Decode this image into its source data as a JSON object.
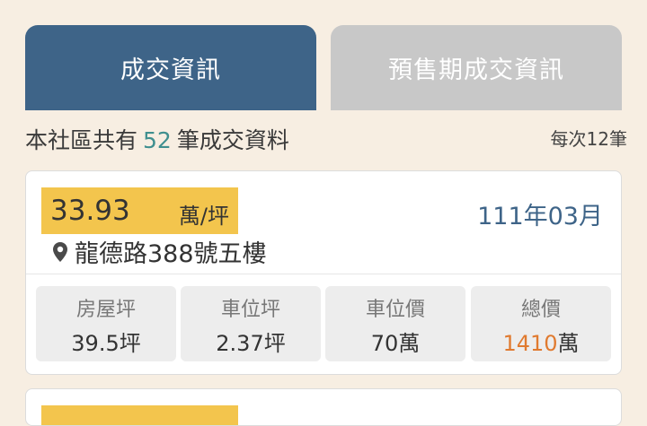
{
  "tabs": [
    {
      "label": "成交資訊",
      "active": true
    },
    {
      "label": "預售期成交資訊",
      "active": false
    }
  ],
  "summary": {
    "prefix": "本社區共有",
    "count": "52",
    "suffix": "筆成交資料",
    "per_page": "每次12筆"
  },
  "record": {
    "price_value": "33.93",
    "price_unit": "萬/坪",
    "date": "111年03月",
    "address": "龍德路388號五樓",
    "stats": [
      {
        "label": "房屋坪",
        "value": "39.5坪"
      },
      {
        "label": "車位坪",
        "value": "2.37坪"
      },
      {
        "label": "車位價",
        "value": "70萬"
      },
      {
        "label": "總價",
        "number": "1410",
        "unit": "萬"
      }
    ]
  },
  "colors": {
    "active_tab": "#3e6488",
    "inactive_tab": "#c8c8c8",
    "price_highlight": "#f3c54d",
    "total_price": "#e07a2f",
    "count_accent": "#3f8f8f",
    "background": "#f7eee2"
  }
}
